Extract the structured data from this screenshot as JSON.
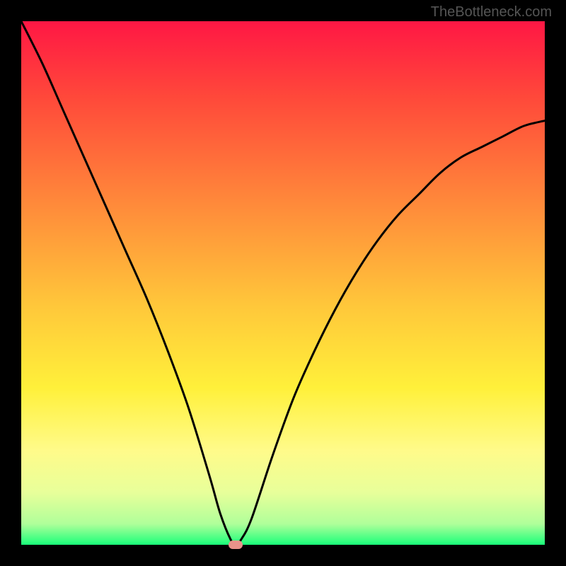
{
  "watermark": "TheBottleneck.com",
  "chart_data": {
    "type": "line",
    "title": "",
    "xlabel": "",
    "ylabel": "",
    "xlim": [
      0,
      100
    ],
    "ylim": [
      0,
      100
    ],
    "background_gradient": {
      "type": "vertical",
      "stops": [
        {
          "pos": 0,
          "color": "#ff1744"
        },
        {
          "pos": 15,
          "color": "#ff4a3a"
        },
        {
          "pos": 35,
          "color": "#ff8a3a"
        },
        {
          "pos": 55,
          "color": "#ffc93a"
        },
        {
          "pos": 70,
          "color": "#fff03a"
        },
        {
          "pos": 82,
          "color": "#fffb8a"
        },
        {
          "pos": 90,
          "color": "#e8ff9a"
        },
        {
          "pos": 96,
          "color": "#b0ff9a"
        },
        {
          "pos": 100,
          "color": "#1aff7a"
        }
      ]
    },
    "series": [
      {
        "name": "bottleneck-curve",
        "color": "#000000",
        "width": 3,
        "x": [
          0,
          4,
          8,
          12,
          16,
          20,
          24,
          28,
          32,
          36,
          38,
          40,
          41,
          42,
          44,
          48,
          52,
          56,
          60,
          64,
          68,
          72,
          76,
          80,
          84,
          88,
          92,
          96,
          100
        ],
        "y": [
          100,
          92,
          83,
          74,
          65,
          56,
          47,
          37,
          26,
          13,
          6,
          1,
          0,
          1,
          5,
          17,
          28,
          37,
          45,
          52,
          58,
          63,
          67,
          71,
          74,
          76,
          78,
          80,
          81
        ]
      }
    ],
    "marker": {
      "x": 41,
      "y": 0,
      "color": "#e8928a"
    }
  }
}
